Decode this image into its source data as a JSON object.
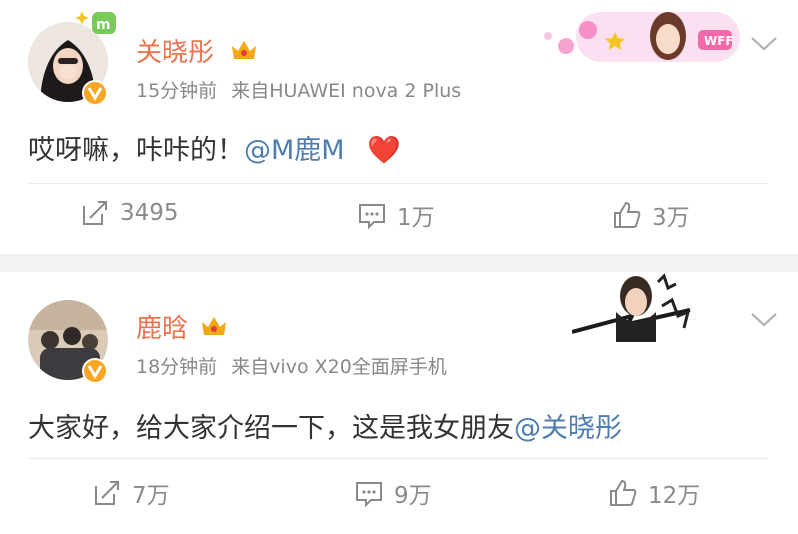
{
  "posts": [
    {
      "author": "关晓彤",
      "time": "15分钟前",
      "source": "来自HUAWEI nova 2 Plus",
      "text": "哎呀嘛，咔咔的！",
      "mention": "@M鹿M",
      "emoji": "❤️",
      "sticker_text": "WFF",
      "actions": {
        "repost": "3495",
        "comment": "1万",
        "like": "3万"
      }
    },
    {
      "author": "鹿晗",
      "time": "18分钟前",
      "source": "来自vivo X20全面屏手机",
      "text": "大家好，给大家介绍一下，这是我女朋友",
      "mention": "@关晓彤",
      "actions": {
        "repost": "7万",
        "comment": "9万",
        "like": "12万"
      }
    }
  ],
  "icons": [
    "repost-icon",
    "comment-icon",
    "like-icon",
    "chevron-down-icon",
    "crown-icon",
    "verified-icon"
  ],
  "colors": {
    "name": "#eb7350",
    "mention": "#507daf",
    "verified": "#f6a623",
    "meta": "#888888"
  }
}
